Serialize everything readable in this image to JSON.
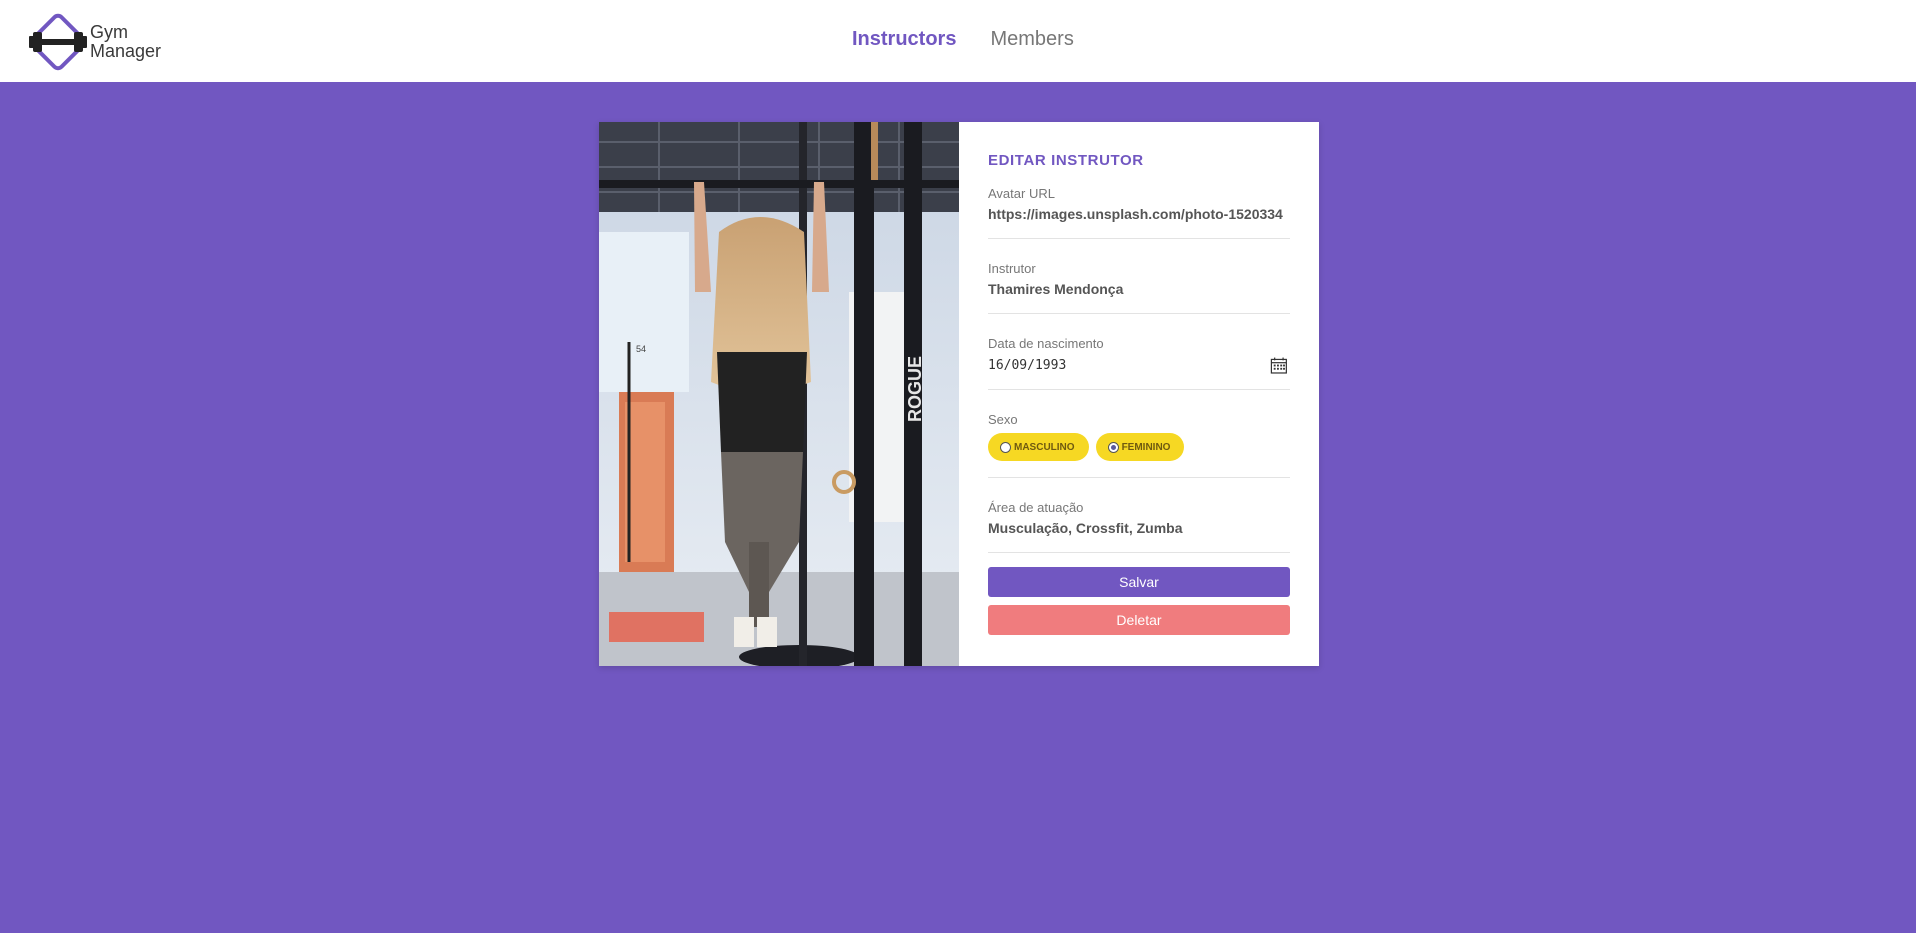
{
  "brand": {
    "name_line1": "Gym",
    "name_line2": "Manager",
    "logo_icon": "dumbbell-icon"
  },
  "nav": {
    "items": [
      {
        "label": "Instructors",
        "active": true
      },
      {
        "label": "Members",
        "active": false
      }
    ]
  },
  "colors": {
    "primary": "#7157c1",
    "accent_yellow": "#f6d823",
    "danger": "#f07c7e"
  },
  "form": {
    "title": "EDITAR INSTRUTOR",
    "avatar": {
      "label": "Avatar URL",
      "value": "https://images.unsplash.com/photo-1520334"
    },
    "name": {
      "label": "Instrutor",
      "value": "Thamires Mendonça"
    },
    "birth": {
      "label": "Data de nascimento",
      "value": "16/09/1993",
      "icon": "calendar-icon"
    },
    "gender": {
      "label": "Sexo",
      "options": [
        {
          "label": "MASCULINO",
          "checked": false
        },
        {
          "label": "FEMININO",
          "checked": true
        }
      ]
    },
    "services": {
      "label": "Área de atuação",
      "value": "Musculação, Crossfit, Zumba"
    },
    "save_label": "Salvar",
    "delete_label": "Deletar"
  },
  "photo": {
    "gym_sign": "ROGUE"
  }
}
